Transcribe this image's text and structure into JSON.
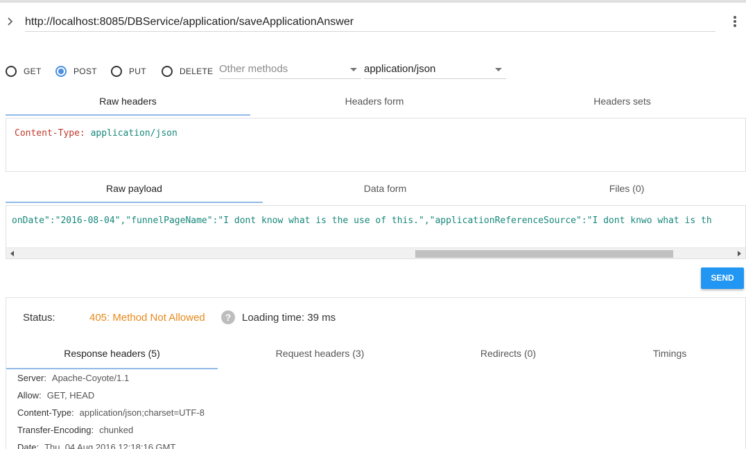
{
  "request": {
    "url": "http://localhost:8085/DBService/application/saveApplicationAnswer",
    "methods": [
      {
        "label": "GET",
        "checked": false
      },
      {
        "label": "POST",
        "checked": true
      },
      {
        "label": "PUT",
        "checked": false
      },
      {
        "label": "DELETE",
        "checked": false
      }
    ],
    "other_methods_placeholder": "Other methods",
    "content_type": "application/json"
  },
  "header_tabs": [
    "Raw headers",
    "Headers form",
    "Headers sets"
  ],
  "raw_headers": {
    "name": "Content-Type:",
    "value": "application/json"
  },
  "payload_tabs": [
    "Raw payload",
    "Data form",
    "Files (0)"
  ],
  "raw_payload": {
    "visible_text": "onDate\":\"2016-08-04\",\"funnelPageName\":\"I dont know what is the use of this.\",\"applicationReferenceSource\":\"I dont knwo what is th"
  },
  "send_label": "SEND",
  "response": {
    "status_label": "Status:",
    "status_value": "405: Method Not Allowed",
    "help_glyph": "?",
    "loading_time": "Loading time: 39 ms",
    "tabs": [
      "Response headers (5)",
      "Request headers (3)",
      "Redirects (0)",
      "Timings"
    ],
    "headers": [
      {
        "name": "Server:",
        "value": "Apache-Coyote/1.1"
      },
      {
        "name": "Allow:",
        "value": "GET, HEAD"
      },
      {
        "name": "Content-Type:",
        "value": "application/json;charset=UTF-8"
      },
      {
        "name": "Transfer-Encoding:",
        "value": "chunked"
      },
      {
        "name": "Date:",
        "value": "Thu, 04 Aug 2016 12:18:16 GMT"
      }
    ]
  },
  "colors": {
    "accent_blue": "#2196f3",
    "status_orange": "#e8891c",
    "code_key_red": "#c0392b",
    "code_value_teal": "#16877a"
  }
}
